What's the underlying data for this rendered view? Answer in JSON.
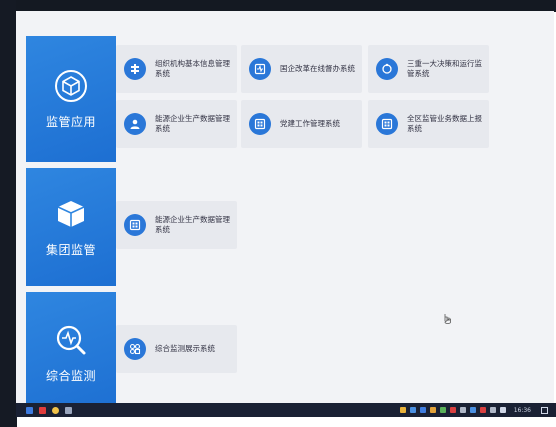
{
  "nav": [
    {
      "label": "监管应用",
      "icon": "cube-icon"
    },
    {
      "label": "集团监管",
      "icon": "box-icon"
    },
    {
      "label": "综合监测",
      "icon": "monitor-search-icon"
    }
  ],
  "cards": {
    "c1": {
      "title": "组织机构基本信息管理系统",
      "icon": "org-plus-icon"
    },
    "c2": {
      "title": "国企改革在线督办系统",
      "icon": "pulse-doc-icon"
    },
    "c3": {
      "title": "三重一大决策和运行监管系统",
      "icon": "ring-icon"
    },
    "c4": {
      "title": "能源企业生产数据管理系统",
      "icon": "person-icon"
    },
    "c5": {
      "title": "党建工作管理系统",
      "icon": "grid-box-icon"
    },
    "c6": {
      "title": "全区监管业务数据上报系统",
      "icon": "grid-box-icon"
    },
    "c7": {
      "title": "能源企业生产数据管理系统",
      "icon": "grid-box-icon"
    },
    "c8": {
      "title": "综合监测展示系统",
      "icon": "dashboard-icon"
    }
  },
  "taskbar": {
    "time": "16:36"
  },
  "colors": {
    "accent": "#2a77d8",
    "nav": "#1d6fd2",
    "card": "#e7e9ee"
  }
}
